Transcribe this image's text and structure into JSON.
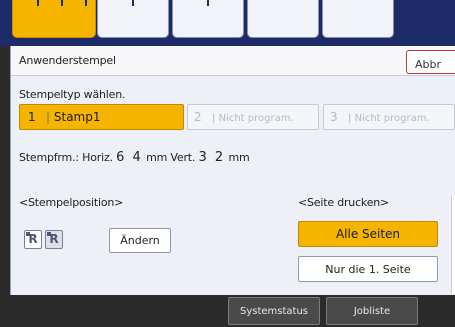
{
  "header": {
    "title": "Anwenderstempel",
    "abort_label": "Abbr"
  },
  "stamp_type": {
    "label": "Stempeltyp wählen.",
    "options": [
      {
        "num": "1",
        "name": "Stamp1",
        "selected": true
      },
      {
        "num": "2",
        "name": "Nicht program.",
        "selected": false
      },
      {
        "num": "3",
        "name": "Nicht program.",
        "selected": false
      }
    ]
  },
  "stamp_size": {
    "prefix": "Stempfrm.: Horiz.",
    "horiz": "6 4",
    "mid": "mm Vert.",
    "vert": "3 2",
    "unit": "mm"
  },
  "position": {
    "label": "<Stempelposition>",
    "icon_letter": "R",
    "change_label": "Ändern"
  },
  "print_pages": {
    "label": "<Seite drucken>",
    "all_label": "Alle Seiten",
    "first_label": "Nur die 1. Seite",
    "selected": "all"
  },
  "bottom": {
    "system_status": "Systemstatus",
    "job_list": "Jobliste"
  },
  "colors": {
    "accent": "#f5b400",
    "tabstrip": "#1d2c68",
    "panel": "#eef0f7"
  }
}
